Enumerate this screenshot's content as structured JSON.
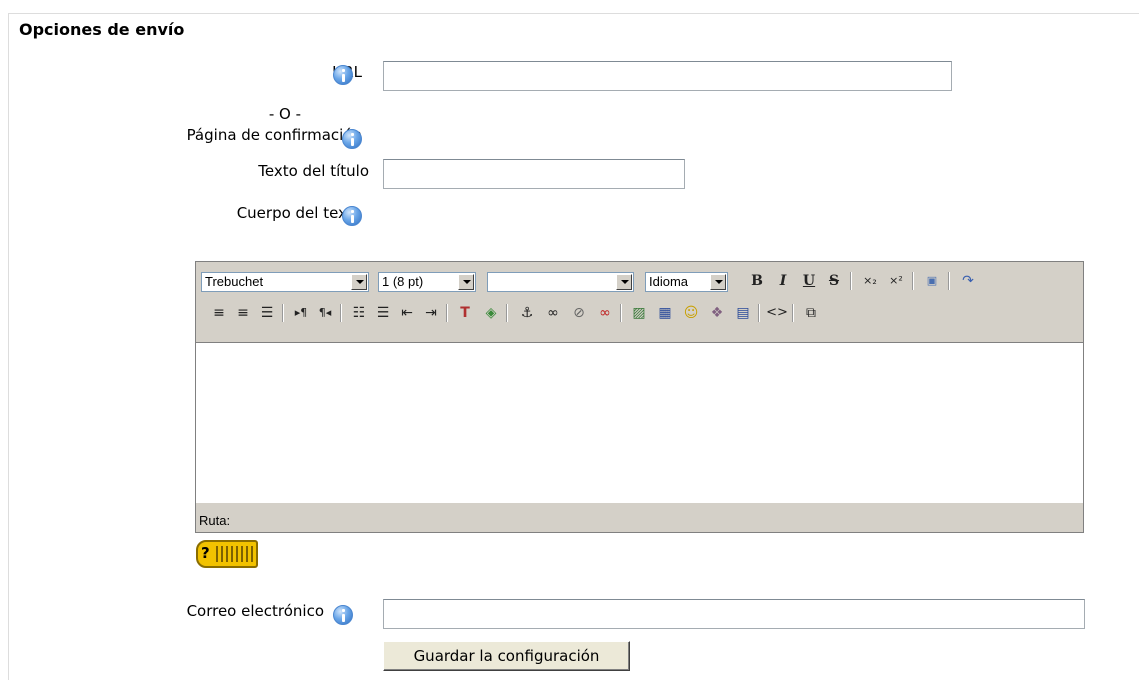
{
  "section": {
    "legend": "Opciones de envío"
  },
  "fields": {
    "url": {
      "label": "URL",
      "value": ""
    },
    "or_separator": "- O -",
    "confirm_page": {
      "label": "Página de confirmación"
    },
    "title_text": {
      "label": "Texto del título",
      "value": ""
    },
    "body_text": {
      "label": "Cuerpo del texto"
    },
    "email": {
      "label": "Correo electrónico",
      "value": ""
    }
  },
  "editor": {
    "font": "Trebuchet",
    "size": "1 (8 pt)",
    "format": "",
    "language": "Idioma",
    "path_label": "Ruta:",
    "toolbar_row1": [
      "bold-icon",
      "italic-icon",
      "underline-icon",
      "strikethrough-icon",
      "subscript-icon",
      "superscript-icon",
      "clean-word-icon",
      "redo-icon"
    ],
    "toolbar_row2": [
      "align-left-icon",
      "align-right-icon",
      "justify-icon",
      "ltr-icon",
      "rtl-icon",
      "ordered-list-icon",
      "unordered-list-icon",
      "outdent-icon",
      "indent-icon",
      "text-color-icon",
      "background-color-icon",
      "anchor-icon",
      "link-icon",
      "unlink-icon",
      "nolink-icon",
      "image-icon",
      "table-icon",
      "smiley-icon",
      "special-char-icon",
      "paste-word-icon",
      "html-source-icon",
      "fullscreen-icon"
    ]
  },
  "actions": {
    "save": "Guardar la configuración"
  },
  "colors": {
    "toolbar_bg": "#d4d0c8",
    "info_icon": "#2f6fc2",
    "keyboard_help": "#f2c200"
  }
}
